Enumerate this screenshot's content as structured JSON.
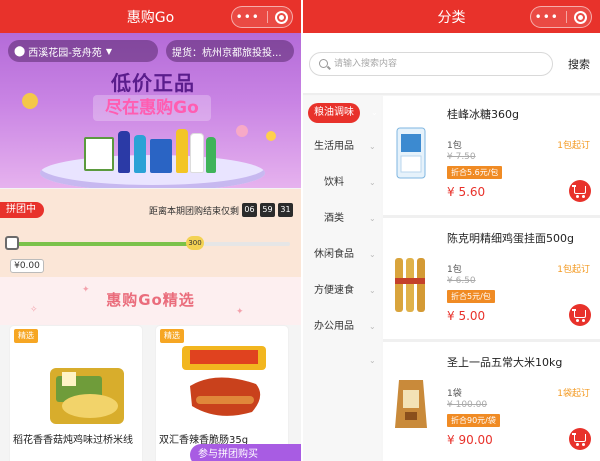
{
  "left": {
    "title": "惠购Go",
    "location": "西溪花园-竞舟苑",
    "pickup": "提货：杭州京都旅投投...",
    "banner": {
      "line1": "低价正品",
      "line2": "尽在惠购Go"
    },
    "group": {
      "tag": "拼团中",
      "countdown_label": "距离本期团购结束仅剩",
      "hours": "06",
      "minutes": "59",
      "seconds": "31",
      "milestone": "300",
      "progress_fraction": 0.65,
      "amount": "¥0.00"
    },
    "section_title": "惠购Go精选",
    "products": [
      {
        "tag": "精选",
        "name": "稻花香香菇炖鸡味过桥米线"
      },
      {
        "tag": "精选",
        "name": "双汇香辣香脆肠35g"
      }
    ],
    "float_button": "参与拼团购买"
  },
  "right": {
    "title": "分类",
    "search": {
      "placeholder": "请输入搜索内容",
      "button": "搜索"
    },
    "categories": [
      {
        "label": "粮油调味",
        "active": true
      },
      {
        "label": "生活用品",
        "active": false
      },
      {
        "label": "饮料",
        "active": false
      },
      {
        "label": "酒类",
        "active": false
      },
      {
        "label": "休闲食品",
        "active": false
      },
      {
        "label": "方便速食",
        "active": false
      },
      {
        "label": "办公用品",
        "active": false
      }
    ],
    "items": [
      {
        "name": "桂峰冰糖360g",
        "unit": "1包",
        "min": "1包起订",
        "orig": "¥ 7.50",
        "promo": "折合5.6元/包",
        "price": "¥ 5.60"
      },
      {
        "name": "陈克明精细鸡蛋挂面500g",
        "unit": "1包",
        "min": "1包起订",
        "orig": "¥ 6.50",
        "promo": "折合5元/包",
        "price": "¥ 5.00"
      },
      {
        "name": "圣上一品五常大米10kg",
        "unit": "1袋",
        "min": "1袋起订",
        "orig": "¥ 100.00",
        "promo": "折合90元/袋",
        "price": "¥ 90.00"
      }
    ]
  },
  "colors": {
    "brand_red": "#e8322b",
    "promo_orange": "#f08b24",
    "banner_purple": "#b46bd8"
  }
}
